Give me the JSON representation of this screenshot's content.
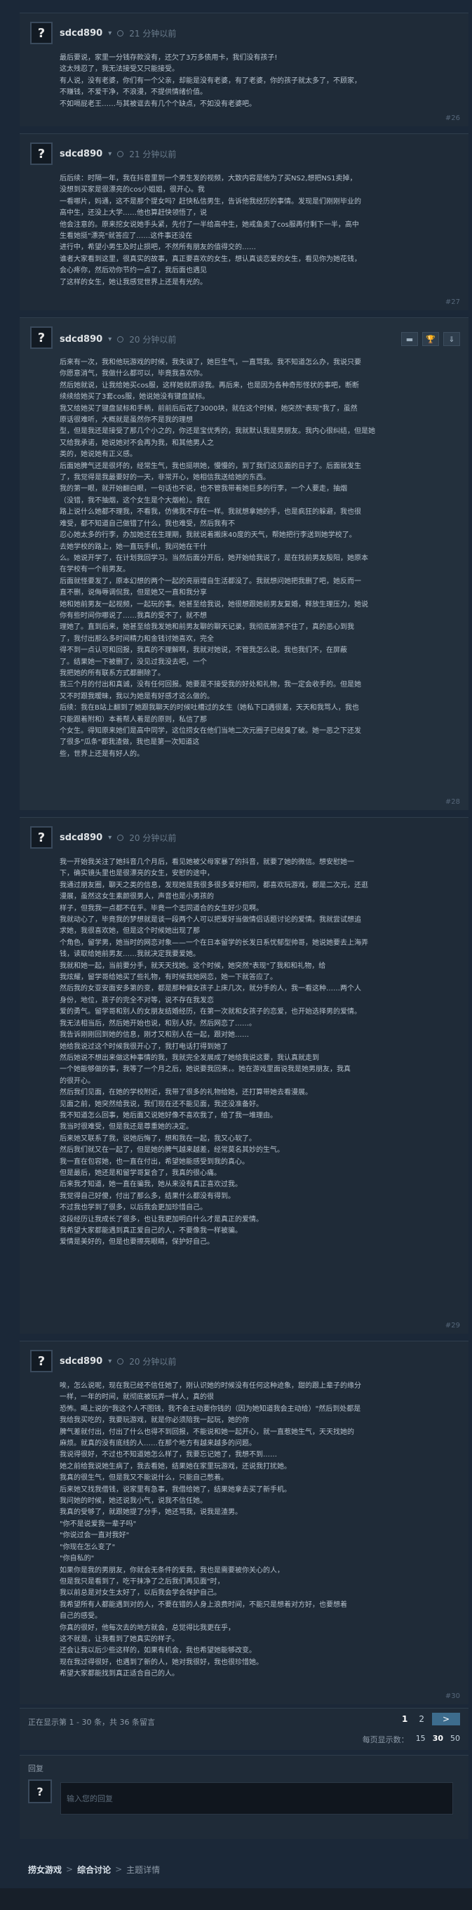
{
  "posts": [
    {
      "author": "sdcd890",
      "author_menu": "▾",
      "time": "21 分钟以前",
      "lines": [
        "最后要说，家里一分钱存款没有，还欠了3万多债用卡，我们没有孩子!",
        "这太残忍了，我无法接受又只能接受。",
        "有人说，没有老婆，你们有一个父亲，却能是没有老婆，有了老婆，你的孩子就太多了，不顾家，",
        "不赚钱，不爱干净，不浪漫，不提供情绪价值。",
        "不如嗝屁老王……与其被诓去有几个个缺点，不如没有老婆吧。"
      ],
      "floor": "#26"
    },
    {
      "author": "sdcd890",
      "author_menu": "▾",
      "time": "21 分钟以前",
      "lines": [
        "后后续：时隔一年，我在抖音里到一个男生发的视频，大致内容是他为了买NS2,想把NS1卖掉，",
        "没想到买家是很漂亮的cos小姐姐，很开心。我",
        "一看哪片，妈通，这不是那个提女吗？赶快私信男生，告诉他我经历的事情。发现是们刚刚毕业的",
        "高中生，还没上大学……他也算赶快领悟了，说",
        "他会注意的。原来挖女说她手头紧，先付了一半给高中生，她戒鱼卖了cos服再付剩下一半，高中",
        "生看她挺\"漂亮\"就答应了……这件事还没在",
        "进行中，希望小男生及时止损吧，不然所有朋友的值得交的……",
        "谁者大家看到这里，很真实的故事，真正要喜欢的女生，想认真谈恋爱的女生，看见你为她花钱，",
        "会心疼你，然后劝你节约一点了，我后面也遇见",
        "了这样的女生，她让我感觉世界上还是有光的。"
      ],
      "floor": "#27"
    },
    {
      "author": "sdcd890",
      "author_menu": "▾",
      "time": "20 分钟以前",
      "lines": [
        "后来有一次，我和他玩游戏的时候，我失误了，她巨生气，一直骂我。我不知道怎么办，我说只要",
        "你愿意消气，我做什么都可以，毕竟我喜欢你。",
        "然后她就说，让我给她买cos服，这样她就原谅我。再后来，也是因为各种奇形怪状的事吧，断断",
        "续续给她买了3套cos服，她说她没有键盘鼠标。",
        "我又给她买了键盘鼠标和手柄，前前后后花了3000块，就在这个时候，她突然\"表现\"我了，虽然",
        "原话很难听，大概就是虽然你不是我的理想",
        "型，但是我还是接受了那几个小之的，你还是宝优秀的，我就默认我是男朋友。我内心很纠结，但是她",
        "又给我承诺，她说她对不会再为我，和其他男人之",
        "类的，她说她有正义感。",
        "后面她脾气还是很坏的，经常生气，我也挺哄她，慢慢的，到了我们这见面的日子了。后面就发生",
        "了，我觉得是我最要好的一天，非常开心，她相信我送给她的东西。",
        "我的第一眼，就开始翻白眼，一句话也不说，也不管我带着她巨多的行李，一个人要走，抽烟",
        "（没错，我不抽烟，这个女生是个大烟枪）。我在",
        "路上说什么她都不理我，不看我，仿佛我不存在一样。我就想拿她的手，也是疯狂的躲避，我也很",
        "难受，都不知道自己做错了什么，我也难受，然后我有不",
        "忍心她太多的行李，办加她还在生理期，我就说着搬床40度的天气，帮她把行李送到她学校了。",
        "去她学校的路上，她一直玩手机，我问她在干什",
        "么。她说开学了，在计划我回学习。当然后面分开后，她开始给我说了，是在找前男友殷阳，她原本",
        "在学校有一个前男友。",
        "后面就怪要发了，原本幻想的两个一起的亮丽增自生活都没了。我就想问她把我删了吧，她反而一",
        "直不删，说侮辱调侃我，但是她又一直和我分享",
        "她和她前男友一起视频，一起玩的事。她甚至给我说，她很想跟她前男友复婚，释放生理压力，她说",
        "你有些时间你哪说了……我真的受不了，就不想",
        "理她了。直到后来，她甚至给我发她和前男友聊的聊天记录，我彻底崩溃不住了，真的恶心到我",
        "了，我付出那么多时间精力和金钱讨她喜欢，完全",
        "得不到一点认可和回报，我真的不理解啊，我就对她说，不管我怎么说。我也我们不，在屏蔽",
        "了。结果她一下被删了，没见过我没去吧，一个",
        "我把她的所有联系方式都删除了。",
        "我三个月的付出和真诚，没有任何回报。她要是不接受我的好处和礼物，我一定会收手的。但是她",
        "又不时跟我暧昧，我以为她是有好感才这么做的。",
        "后续：我在B站上翻到了她跟我聊天的时候吐槽过的女生（她私下口遇很差，天天和我骂人，我也",
        "只能跟着附和）本着帮人着是的原则，私信了那",
        "个女生。得知原来她们是高中同学，这位捞女在他们当地二次元圈子已经臭了破。她一恶之下还发",
        "了很多\"瓜条\"都我渣做，我也是第一次知道这",
        "些，世界上还是有好人的。"
      ],
      "floor": "#28"
    },
    {
      "author": "sdcd890",
      "author_menu": "▾",
      "time": "20 分钟以前",
      "lines": [
        "我一开始我关注了她抖音几个月后，看见她被父母家暴了的抖音，就要了她的微信。想安慰她一",
        "下，确实镜头里也是很漂亮的女生，安慰的途中，",
        "我通过朋友圈，聊天之类的信息，发现她是我很多很多爱好相同，都喜欢玩游戏，都是二次元，还逛",
        "漫展，虽然这女生素颜很男人，声音也是小男孩的",
        "样子，但我我一点都不在乎。毕竟一个志同道合的女生好少见啊。",
        "我就动心了，毕竟我的梦想就是谈一段两个人可以把爱好当做情侣话题讨论的爱情。我就尝试想追",
        "求她，我很喜欢她，但是这个时候她出现了那",
        "个角色，留学男，她当时的网恋对象——一个在日本留学的长发日系忧郁型帅哥，她说她要去上海弄",
        "钱，读取给她前男友……我就决定我要爱她。",
        "我就和她一起，当前要分手，就天天找她。这个时候，她突然\"表现\"了我和和礼物，给",
        "我炫耀，留学哥给她买了些礼物，有时候我她网恋，她一下就答应了。",
        "然后我的女亚安面安多第的变，都是那种偏女孩子上床几次，就分手的人，我一看这种……两个人",
        "身份，地位，孩子的完全不对等，说不存在我发恋",
        "爱的勇气。留学哥和别人的女朋友结婚经历，在第一次就和女孩子的恋爱，也开始选择男的爱情。",
        "我无法相当后，然后她开始也说，和别人好。然后网恋了……。",
        "我告诉刚刚回到她的信息，刚才又和别人在一起，跟对她……",
        "她给我说过这个时候我很开心了，我打电话打得到她了",
        "然后她说不想出来做这种事情的我，我就完全发展成了她给我说这要，我认真就走到",
        "一个她能够做的事，我等了一个月之后，她说要我回来，。她在游戏里面说我是她男朋友，我真",
        "的很开心。",
        "然后我们见面，在她的学校附近，我带了很多的礼物给她，还打算带她去看漫展。",
        "见面之前，她突然给我说，我们现在还不能见面，我还没准备好。",
        "我不知道怎么回事，她后面又说她好像不喜欢我了，给了我一堆理由。",
        "我当时很难受，但是我还是尊重她的决定。",
        "后来她又联系了我，说她后悔了，想和我在一起，我又心软了。",
        "然后我们就又在一起了，但是她的脾气越来越差，经常莫名其妙的生气。",
        "我一直在包容她，也一直在付出，希望她能感受到我的真心。",
        "但是最后，她还是和留学哥复合了，我真的很心痛。",
        "后来我才知道，她一直在骗我，她从来没有真正喜欢过我。",
        "我觉得自己好傻，付出了那么多，结果什么都没有得到。",
        "不过我也学到了很多，以后我会更加珍惜自己。",
        "这段经历让我成长了很多，也让我更加明白什么才是真正的爱情。",
        "我希望大家都能遇到真正爱自己的人，不要像我一样被骗。",
        "爱情是美好的，但是也要擦亮眼睛，保护好自己。"
      ],
      "floor": "#29"
    },
    {
      "author": "sdcd890",
      "author_menu": "▾",
      "time": "20 分钟以前",
      "lines": [
        "唉，怎么说呢，现在我已经不信任她了，刚认识她的时候没有任何这种迹象，甜的跟上辈子的缘分",
        "一样，一年的时间，就彻底被玩弄一样人，真的很",
        "恐怖。喝上说的\"我这个人不图钱，我不会主动要你钱的（因为她知道我会主动给）\"然后到处都是",
        "我给我买吃的，我要玩游戏，就是你必须陪我一起玩，她的你",
        "脾气差就付出，付出了什么也得不到回报，不能说和她一起开心，就一直惹她生气，天天找她的",
        "麻烦。就真的没有底线的人……在那个地方有越来越多的问题。",
        "我说得很好，不过也不知道她怎么样了，我要忘记她了，我想不到……",
        "她之前给我说她生病了，我去看她，结果她在家里玩游戏，还说我打扰她。",
        "我真的很生气，但是我又不能说什么，只能自己憋着。",
        "后来她又找我借钱，说家里有急事，我借给她了，结果她拿去买了新手机。",
        "我问她的时候，她还说我小气，说我不信任她。",
        "我真的受够了，就跟她提了分手，她还骂我，说我是渣男。",
        "\"你不是说爱我一辈子吗\"",
        "\"你说过会一直对我好\"",
        "\"你现在怎么变了\"",
        "\"你自私的\"",
        "如果你是我的男朋友，你就会无条件的爱我，我也是需要被你关心的人，",
        "但是我只是看到了，吃干抹净了之后我们再见面\"时，",
        "我以前总是对女生太好了，以后我会学会保护自己。",
        "我希望所有人都能遇到对的人，不要在错的人身上浪费时间，不能只是想着对方好，也要想着",
        "自己的感受。",
        "你真的很好，他每次去的地方就会，总觉得比我更在乎，",
        "这不就是，让我看到了她真实的样子。",
        "还会让我以后少些这样的，如果有机会，我也希望她能够改变。",
        "现在我过得很好，也遇到了新的人，她对我很好，我也很珍惜她。",
        "希望大家都能找到真正适合自己的人。"
      ],
      "floor": "#30"
    }
  ],
  "pager": {
    "summary": "正在显示第 1 - 30 条，共 36 条留言",
    "pages": [
      "1",
      "2"
    ],
    "current": "1",
    "next_label": ">",
    "per_page_label": "每页显示数：",
    "per_page_options": [
      "15",
      "30",
      "50"
    ],
    "per_page_selected": "30"
  },
  "reply": {
    "label": "回复",
    "placeholder": "输入您的回复"
  },
  "breadcrumb": {
    "items": [
      "捞女游戏",
      "综合讨论",
      "主题详情"
    ],
    "separator": ">"
  }
}
